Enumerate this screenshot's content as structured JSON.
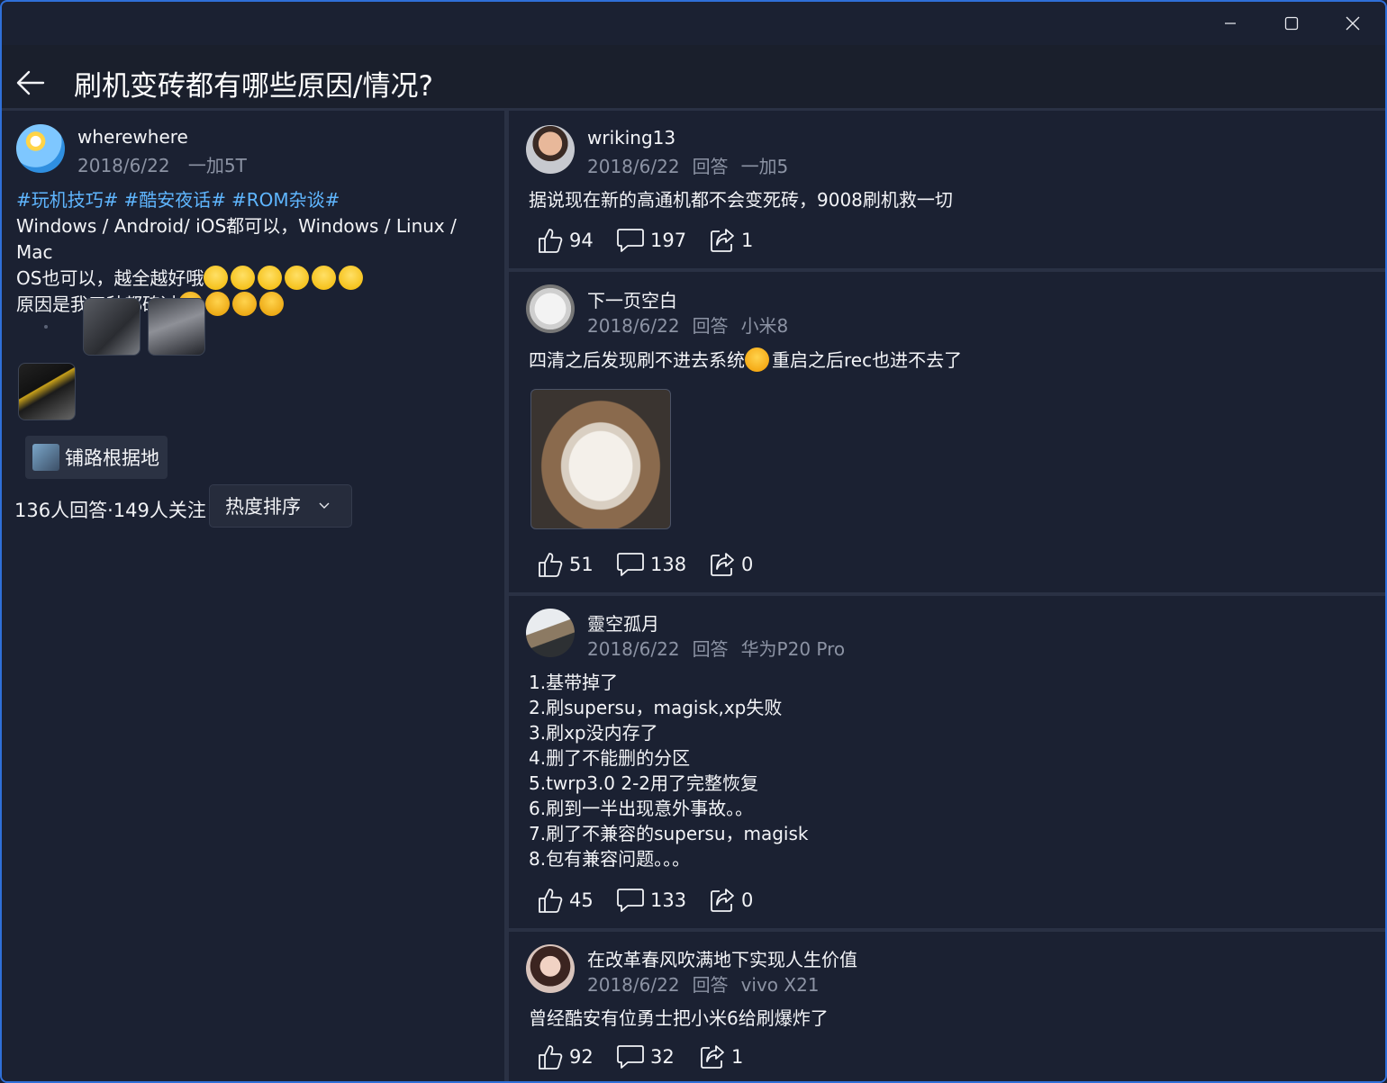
{
  "window": {
    "minimize_icon": "minimize-icon",
    "maximize_icon": "maximize-icon",
    "close_icon": "close-icon"
  },
  "header": {
    "title": "刷机变砖都有哪些原因/情况?",
    "back_icon": "back-arrow-icon"
  },
  "question": {
    "author": "wherewhere",
    "date": "2018/6/22",
    "device": "一加5T",
    "tags": [
      "#玩机技巧#",
      "#酷安夜话#",
      "#ROM杂谈#"
    ],
    "line1": "Windows / Android/ iOS都可以，Windows / Linux / Mac",
    "line2": "OS也可以，越全越好哦",
    "line3": "原因是我三种都砖过",
    "topic": "铺路根据地",
    "stats": "136人回答·149人关注",
    "sort_label": "热度排序"
  },
  "answers": [
    {
      "author": "wriking13",
      "date": "2018/6/22",
      "reply": "回答",
      "device": "一加5",
      "text": "据说现在新的高通机都不会变死砖，9008刷机救一切",
      "likes": "94",
      "comments": "197",
      "shares": "1"
    },
    {
      "author": "下一页空白",
      "date": "2018/6/22",
      "reply": "回答",
      "device": "小米8",
      "text_a": "四清之后发现刷不进去系统",
      "text_b": "重启之后rec也进不去了",
      "likes": "51",
      "comments": "138",
      "shares": "0"
    },
    {
      "author": "靈空孤月",
      "date": "2018/6/22",
      "reply": "回答",
      "device": "华为P20 Pro",
      "lines": [
        "1.基带掉了",
        "2.刷supersu，magisk,xp失败",
        "3.刷xp没内存了",
        "4.删了不能删的分区",
        "5.twrp3.0 2-2用了完整恢复",
        "6.刷到一半出现意外事故。。",
        "7.刷了不兼容的supersu，magisk",
        "8.包有兼容问题。。。"
      ],
      "likes": "45",
      "comments": "133",
      "shares": "0"
    },
    {
      "author": "在改革春风吹满地下实现人生价值",
      "date": "2018/6/22",
      "reply": "回答",
      "device": "vivo X21",
      "text": "曾经酷安有位勇士把小米6给刷爆炸了",
      "likes": "92",
      "comments": "32",
      "shares": "1"
    }
  ]
}
